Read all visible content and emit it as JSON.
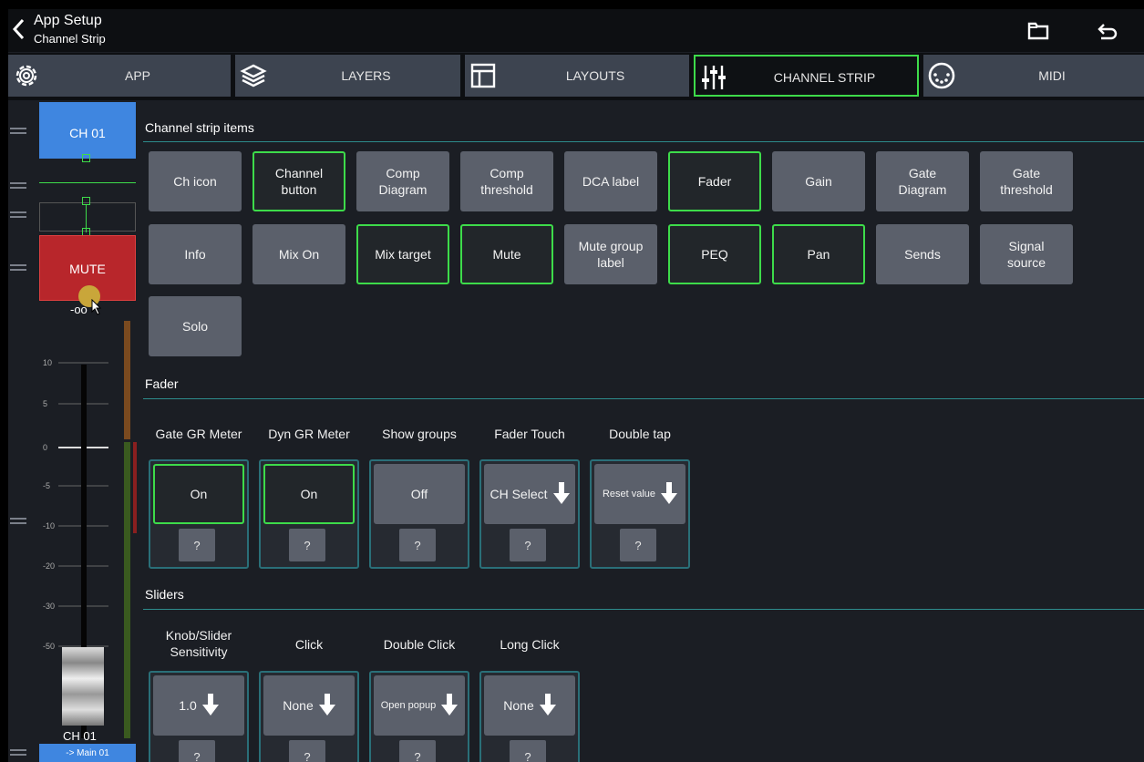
{
  "header": {
    "title": "App Setup",
    "subtitle": "Channel Strip",
    "icons": [
      "back-chevron-icon",
      "folder-icon",
      "undo-icon"
    ]
  },
  "tabs": [
    {
      "label": "APP",
      "icon": "gear-icon",
      "active": false
    },
    {
      "label": "LAYERS",
      "icon": "layers-icon",
      "active": false
    },
    {
      "label": "LAYOUTS",
      "icon": "layout-icon",
      "active": false
    },
    {
      "label": "CHANNEL STRIP",
      "icon": "sliders-icon",
      "active": true
    },
    {
      "label": "MIDI",
      "icon": "midi-connector-icon",
      "active": false
    }
  ],
  "strip": {
    "channel": "CH 01",
    "mute": "MUTE",
    "level": "-oo",
    "scale": [
      "10",
      "5",
      "0",
      "-5",
      "-10",
      "-20",
      "-30",
      "-50"
    ],
    "bottom_name": "CH 01",
    "bottom_target": "-> Main 01"
  },
  "sections": {
    "items_title": "Channel strip items",
    "fader_title": "Fader",
    "sliders_title": "Sliders"
  },
  "strip_items": [
    {
      "label": "Ch icon",
      "selected": false
    },
    {
      "label": "Channel button",
      "selected": true
    },
    {
      "label": "Comp Diagram",
      "selected": false
    },
    {
      "label": "Comp threshold",
      "selected": false
    },
    {
      "label": "DCA label",
      "selected": false
    },
    {
      "label": "Fader",
      "selected": true
    },
    {
      "label": "Gain",
      "selected": false
    },
    {
      "label": "Gate Diagram",
      "selected": false
    },
    {
      "label": "Gate threshold",
      "selected": false
    },
    {
      "label": "Info",
      "selected": false
    },
    {
      "label": "Mix On",
      "selected": false
    },
    {
      "label": "Mix target",
      "selected": true
    },
    {
      "label": "Mute",
      "selected": true
    },
    {
      "label": "Mute group label",
      "selected": false
    },
    {
      "label": "PEQ",
      "selected": true
    },
    {
      "label": "Pan",
      "selected": true
    },
    {
      "label": "Sends",
      "selected": false
    },
    {
      "label": "Signal source",
      "selected": false
    },
    {
      "label": "Solo",
      "selected": false
    }
  ],
  "fader_options": [
    {
      "label": "Gate GR Meter",
      "value": "On",
      "selected": true,
      "dropdown": false,
      "help": "?"
    },
    {
      "label": "Dyn GR Meter",
      "value": "On",
      "selected": true,
      "dropdown": false,
      "help": "?"
    },
    {
      "label": "Show groups",
      "value": "Off",
      "selected": false,
      "dropdown": false,
      "help": "?"
    },
    {
      "label": "Fader Touch",
      "value": "CH Select",
      "selected": false,
      "dropdown": true,
      "help": "?"
    },
    {
      "label": "Double tap",
      "value": "Reset value",
      "selected": false,
      "dropdown": true,
      "help": "?"
    }
  ],
  "slider_options": [
    {
      "label": "Knob/Slider Sensitivity",
      "value": "1.0",
      "dropdown": true,
      "help": "?"
    },
    {
      "label": "Click",
      "value": "None",
      "dropdown": true,
      "help": "?"
    },
    {
      "label": "Double Click",
      "value": "Open popup",
      "dropdown": true,
      "help": "?"
    },
    {
      "label": "Long Click",
      "value": "None",
      "dropdown": true,
      "help": "?"
    }
  ],
  "colors": {
    "accent_green": "#3ddb4a",
    "section_line": "#2d8c8c",
    "button_gray": "#5b606b",
    "channel_blue": "#3f86e0",
    "mute_red": "#b8262b"
  }
}
